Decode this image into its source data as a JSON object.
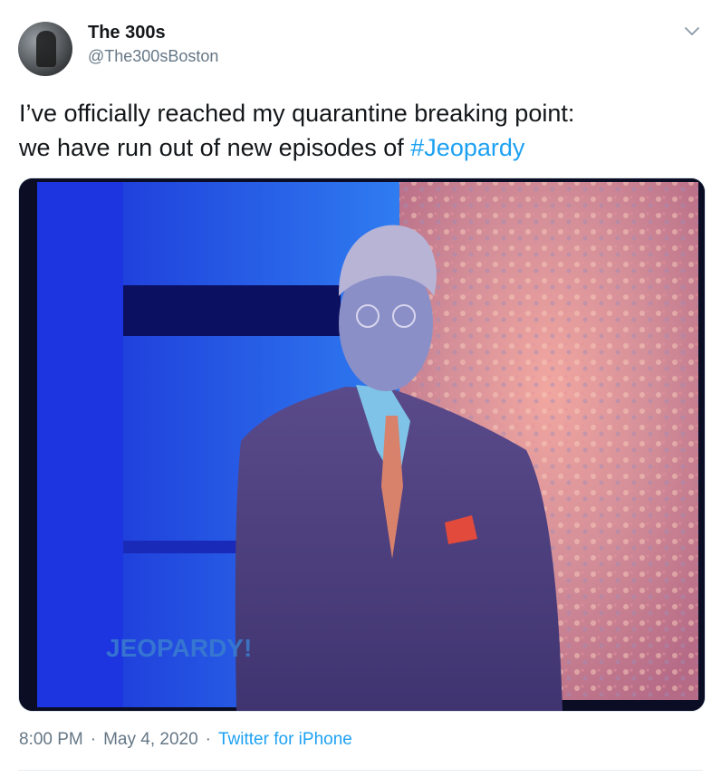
{
  "author": {
    "display_name": "The 300s",
    "handle": "@The300sBoston"
  },
  "tweet": {
    "text_line1": "I’ve officially reached my quarantine breaking point:",
    "text_line2_prefix": "we have run out of new episodes of ",
    "hashtag": "#Jeopardy"
  },
  "media": {
    "logo_text": "JEOPARDY!"
  },
  "footer": {
    "time": "8:00 PM",
    "date": "May 4, 2020",
    "separator": "·",
    "source": "Twitter for iPhone"
  },
  "icons": {
    "menu": "chevron-down-icon",
    "avatar": "profile-photo"
  },
  "colors": {
    "link": "#1da1f2",
    "secondary_text": "#657786",
    "primary_text": "#14171a"
  }
}
